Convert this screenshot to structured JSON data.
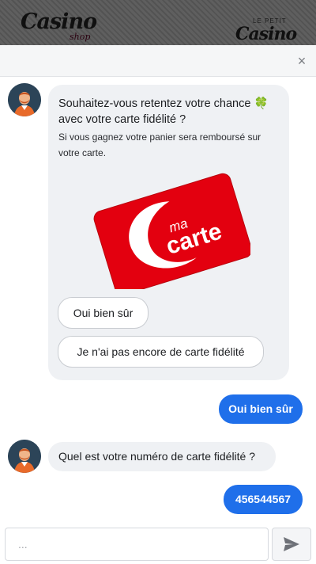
{
  "brand": {
    "left_logo": "Casino",
    "left_logo_sub": "shop",
    "right_logo_top": "LE PETIT",
    "right_logo": "Casino"
  },
  "header": {
    "close_symbol": "×"
  },
  "messages": {
    "bot_offer": {
      "title": "Souhaitez-vous retentez votre chance 🍀 avec votre carte fidélité ?",
      "subtitle": "Si vous gagnez votre panier sera remboursé sur votre carte.",
      "card_text_ma": "ma",
      "card_text_carte": "carte",
      "choices": [
        "Oui bien sûr",
        "Je n'ai pas encore de carte fidélité"
      ]
    },
    "user_reply_1": "Oui bien sûr",
    "bot_question": "Quel est votre numéro de carte fidélité ?",
    "user_reply_2": "456544567"
  },
  "composer": {
    "placeholder": "...",
    "value": ""
  },
  "colors": {
    "user_bubble": "#1f6fea",
    "bot_bubble": "#eff1f4",
    "card_red": "#e3000f",
    "avatar_bg": "#2c4458"
  }
}
